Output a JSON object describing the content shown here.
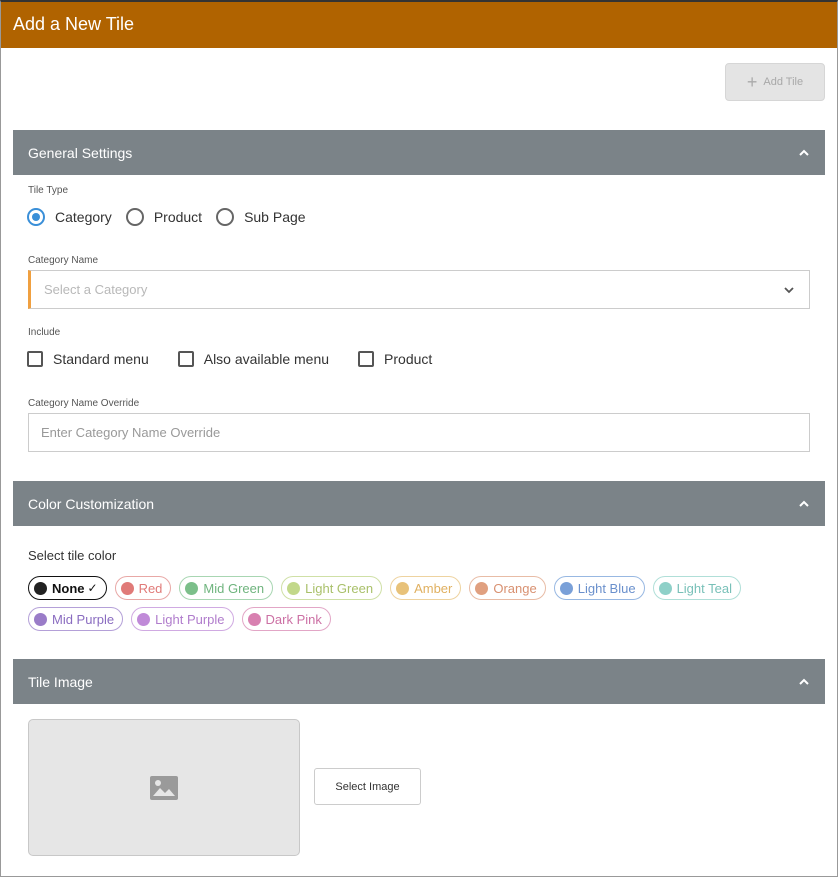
{
  "header": {
    "title": "Add a New Tile"
  },
  "toolbar": {
    "add_tile_label": "Add Tile"
  },
  "general": {
    "title": "General Settings",
    "tile_type_label": "Tile Type",
    "tile_types": [
      "Category",
      "Product",
      "Sub Page"
    ],
    "selected_tile_type": "Category",
    "category_name_label": "Category Name",
    "category_placeholder": "Select a Category",
    "include_label": "Include",
    "include_options": [
      "Standard menu",
      "Also available menu",
      "Product"
    ],
    "override_label": "Category Name Override",
    "override_placeholder": "Enter Category Name Override"
  },
  "color": {
    "title": "Color Customization",
    "select_label": "Select tile color",
    "options": [
      {
        "name": "None",
        "dot": "#222222",
        "text": "#111111",
        "border": "#111111",
        "selected": true
      },
      {
        "name": "Red",
        "dot": "#e07a78",
        "text": "#e07a78",
        "border": "#e8a8a6"
      },
      {
        "name": "Mid Green",
        "dot": "#7cbf8a",
        "text": "#6fb47e",
        "border": "#a8d6b2"
      },
      {
        "name": "Light Green",
        "dot": "#c2d88a",
        "text": "#a9c06a",
        "border": "#cfe0a6"
      },
      {
        "name": "Amber",
        "dot": "#e8c27a",
        "text": "#e0b060",
        "border": "#eed3a0"
      },
      {
        "name": "Orange",
        "dot": "#e0a080",
        "text": "#d89070",
        "border": "#e8bca6"
      },
      {
        "name": "Light Blue",
        "dot": "#7aa0d8",
        "text": "#6a90cc",
        "border": "#98b8e2"
      },
      {
        "name": "Light Teal",
        "dot": "#8ed0c8",
        "text": "#78c0b8",
        "border": "#b0dfd8"
      },
      {
        "name": "Mid Purple",
        "dot": "#9a7cc8",
        "text": "#8a6cc0",
        "border": "#b4a0d8"
      },
      {
        "name": "Light Purple",
        "dot": "#c08ad8",
        "text": "#b07ccc",
        "border": "#d0aae2"
      },
      {
        "name": "Dark Pink",
        "dot": "#d880b0",
        "text": "#cc70a4",
        "border": "#e2a6c6"
      }
    ]
  },
  "image": {
    "title": "Tile Image",
    "select_image_label": "Select Image"
  },
  "theme": {
    "accent": "#b06300",
    "section_bg": "#7b8388",
    "radio_active": "#3a8fd8"
  }
}
